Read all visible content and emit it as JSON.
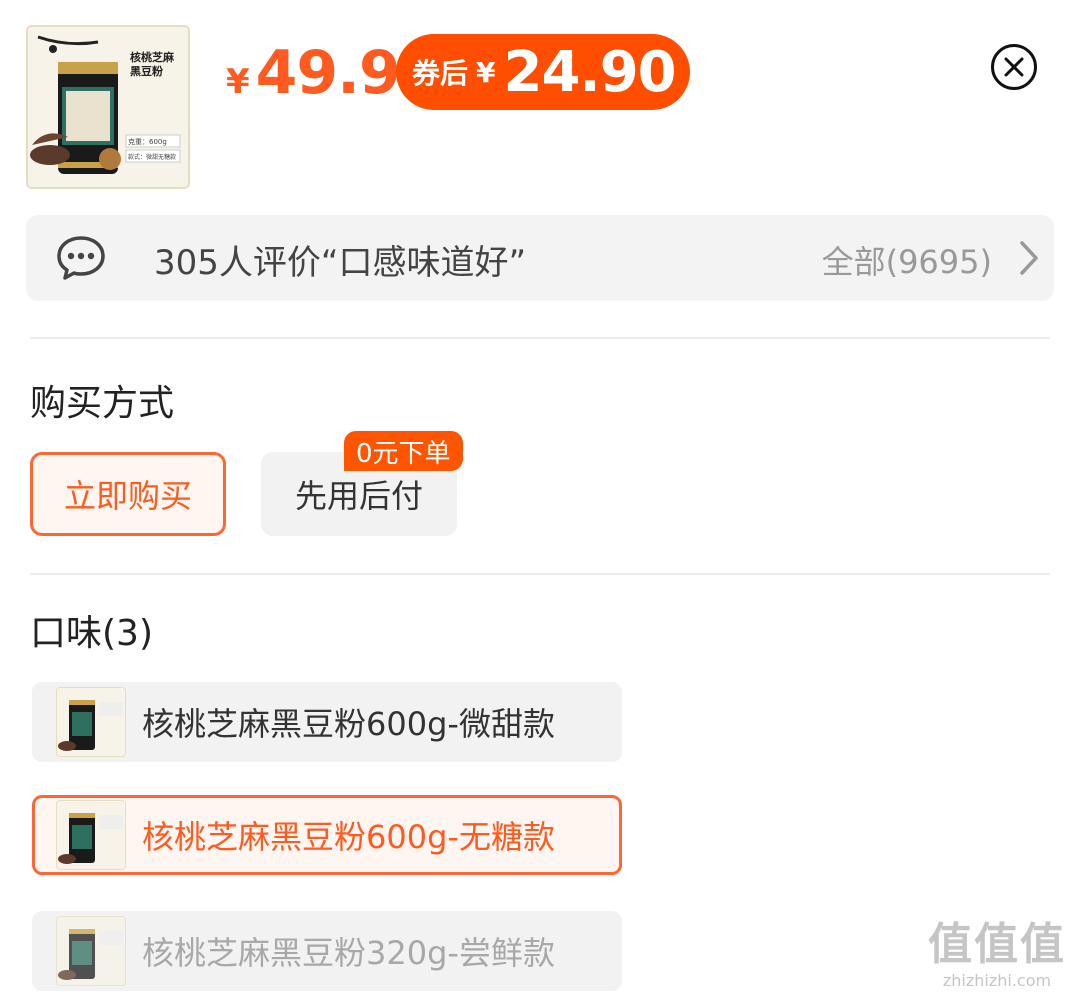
{
  "product": {
    "thumbnail_alt": "核桃芝麻黑豆粉",
    "thumb_title": "核桃芝麻\n黑豆粉",
    "thumb_weight": "克重：600g",
    "thumb_flavor": "款式：微甜无糖款"
  },
  "price": {
    "currency": "¥",
    "original": "49.9",
    "coupon_label": "券后",
    "coupon_price": "24.90"
  },
  "review": {
    "summary": "305人评价“口感味道好”",
    "all_label": "全部(9695)"
  },
  "purchase": {
    "title": "购买方式",
    "buy_now": "立即购买",
    "pay_later": "先用后付",
    "pay_later_badge": "0元下单"
  },
  "flavor": {
    "title": "口味(3)",
    "options": [
      {
        "label": "核桃芝麻黑豆粉600g-微甜款",
        "state": "normal"
      },
      {
        "label": "核桃芝麻黑豆粉600g-无糖款",
        "state": "selected"
      },
      {
        "label": "核桃芝麻黑豆粉320g-尝鲜款",
        "state": "disabled"
      }
    ]
  },
  "watermark": {
    "big": "值值值",
    "small": "zhizhizhi.com"
  },
  "colors": {
    "accent": "#ff5a1f",
    "badge": "#ff4e00"
  }
}
